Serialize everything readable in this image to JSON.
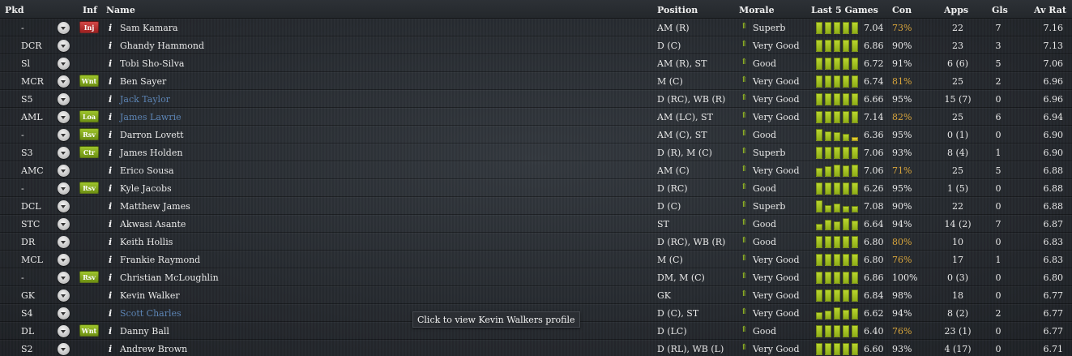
{
  "header": {
    "pkd": "Pkd",
    "inf": "Inf",
    "name": "Name",
    "position": "Position",
    "morale": "Morale",
    "last5": "Last 5 Games",
    "con": "Con",
    "apps": "Apps",
    "gls": "Gls",
    "avrat": "Av Rat"
  },
  "colors": {
    "morale_arrow": "#a6d020",
    "form_green": "#a6c622",
    "form_yellow": "#d8c62a",
    "con_warning": "#d8a53c",
    "link_blue": "#5c84b4"
  },
  "rows": [
    {
      "pkd": "-",
      "inf": "Inj",
      "inf_color": "red",
      "name": "Sam Kamara",
      "name_link": false,
      "position": "AM (R)",
      "morale": "Superb",
      "form": [
        1,
        1,
        1,
        1,
        1
      ],
      "form_rating": "7.04",
      "con": "73%",
      "con_warn": true,
      "apps": "22",
      "gls": "7",
      "avrat": "7.16"
    },
    {
      "pkd": "DCR",
      "inf": "",
      "name": "Ghandy Hammond",
      "name_link": false,
      "position": "D (C)",
      "morale": "Very Good",
      "form": [
        1,
        1,
        1,
        1,
        1
      ],
      "form_rating": "6.86",
      "con": "90%",
      "con_warn": false,
      "apps": "23",
      "gls": "3",
      "avrat": "7.13"
    },
    {
      "pkd": "Sl",
      "inf": "",
      "name": "Tobi Sho-Silva",
      "name_link": false,
      "position": "AM (R), ST",
      "morale": "Good",
      "form": [
        1,
        1,
        1,
        1,
        1
      ],
      "form_rating": "6.72",
      "con": "91%",
      "con_warn": false,
      "apps": "6 (6)",
      "gls": "5",
      "avrat": "7.06"
    },
    {
      "pkd": "MCR",
      "inf": "Wnt",
      "inf_color": "green",
      "name": "Ben Sayer",
      "name_link": false,
      "position": "M (C)",
      "morale": "Very Good",
      "form": [
        1,
        1,
        1,
        1,
        1
      ],
      "form_rating": "6.74",
      "con": "81%",
      "con_warn": true,
      "apps": "25",
      "gls": "2",
      "avrat": "6.96"
    },
    {
      "pkd": "S5",
      "inf": "",
      "name": "Jack Taylor",
      "name_link": true,
      "position": "D (RC), WB (R)",
      "morale": "Very Good",
      "form": [
        1,
        1,
        1,
        1,
        1
      ],
      "form_rating": "6.66",
      "con": "95%",
      "con_warn": false,
      "apps": "15 (7)",
      "gls": "0",
      "avrat": "6.96"
    },
    {
      "pkd": "AML",
      "inf": "Loa",
      "inf_color": "green",
      "name": "James Lawrie",
      "name_link": true,
      "position": "AM (LC), ST",
      "morale": "Very Good",
      "form": [
        1,
        1,
        1,
        1,
        1
      ],
      "form_rating": "7.14",
      "con": "82%",
      "con_warn": true,
      "apps": "25",
      "gls": "6",
      "avrat": "6.94"
    },
    {
      "pkd": "-",
      "inf": "Rsv",
      "inf_color": "green",
      "name": "Darron Lovett",
      "name_link": false,
      "position": "AM (C), ST",
      "morale": "Good",
      "form": [
        1,
        0.8,
        0.75,
        0.6,
        0.35
      ],
      "form_rating": "6.36",
      "con": "95%",
      "con_warn": false,
      "apps": "0 (1)",
      "gls": "0",
      "avrat": "6.90"
    },
    {
      "pkd": "S3",
      "inf": "Ctr",
      "inf_color": "green",
      "name": "James Holden",
      "name_link": false,
      "position": "D (R), M (C)",
      "morale": "Superb",
      "form": [
        1,
        1,
        1,
        1,
        1
      ],
      "form_rating": "7.06",
      "con": "93%",
      "con_warn": false,
      "apps": "8 (4)",
      "gls": "1",
      "avrat": "6.90"
    },
    {
      "pkd": "AMC",
      "inf": "",
      "name": "Erico Sousa",
      "name_link": false,
      "position": "AM (C)",
      "morale": "Very Good",
      "form": [
        0.75,
        0.85,
        1,
        0.9,
        1
      ],
      "form_rating": "7.06",
      "con": "71%",
      "con_warn": true,
      "apps": "25",
      "gls": "5",
      "avrat": "6.88"
    },
    {
      "pkd": "-",
      "inf": "Rsv",
      "inf_color": "green",
      "name": "Kyle Jacobs",
      "name_link": false,
      "position": "D (RC)",
      "morale": "Good",
      "form": [
        1,
        1,
        1,
        1,
        1
      ],
      "form_rating": "6.26",
      "con": "95%",
      "con_warn": false,
      "apps": "1 (5)",
      "gls": "0",
      "avrat": "6.88"
    },
    {
      "pkd": "DCL",
      "inf": "",
      "name": "Matthew James",
      "name_link": false,
      "position": "D (C)",
      "morale": "Superb",
      "form": [
        1,
        0.6,
        0.75,
        0.55,
        0.5
      ],
      "form_rating": "7.08",
      "con": "90%",
      "con_warn": false,
      "apps": "22",
      "gls": "0",
      "avrat": "6.88"
    },
    {
      "pkd": "STC",
      "inf": "",
      "name": "Akwasi Asante",
      "name_link": false,
      "position": "ST",
      "morale": "Good",
      "form": [
        0.55,
        0.85,
        0.7,
        1,
        0.8
      ],
      "form_rating": "6.64",
      "con": "94%",
      "con_warn": false,
      "apps": "14 (2)",
      "gls": "7",
      "avrat": "6.87"
    },
    {
      "pkd": "DR",
      "inf": "",
      "name": "Keith Hollis",
      "name_link": false,
      "position": "D (RC), WB (R)",
      "morale": "Good",
      "form": [
        1,
        1,
        1,
        1,
        1
      ],
      "form_rating": "6.80",
      "con": "80%",
      "con_warn": true,
      "apps": "10",
      "gls": "0",
      "avrat": "6.83"
    },
    {
      "pkd": "MCL",
      "inf": "",
      "name": "Frankie Raymond",
      "name_link": false,
      "position": "M (C)",
      "morale": "Very Good",
      "form": [
        1,
        1,
        1,
        1,
        1
      ],
      "form_rating": "6.80",
      "con": "76%",
      "con_warn": true,
      "apps": "17",
      "gls": "1",
      "avrat": "6.83"
    },
    {
      "pkd": "-",
      "inf": "Rsv",
      "inf_color": "green",
      "name": "Christian McLoughlin",
      "name_link": false,
      "position": "DM, M (C)",
      "morale": "Very Good",
      "form": [
        1,
        1,
        1,
        1,
        1
      ],
      "form_rating": "6.86",
      "con": "100%",
      "con_warn": false,
      "apps": "0 (3)",
      "gls": "0",
      "avrat": "6.80"
    },
    {
      "pkd": "GK",
      "inf": "",
      "name": "Kevin Walker",
      "name_link": false,
      "position": "GK",
      "morale": "Very Good",
      "form": [
        1,
        1,
        1,
        1,
        1
      ],
      "form_rating": "6.84",
      "con": "98%",
      "con_warn": false,
      "apps": "18",
      "gls": "0",
      "avrat": "6.77"
    },
    {
      "pkd": "S4",
      "inf": "",
      "name": "Scott Charles",
      "name_link": true,
      "position": "D (C), ST",
      "morale": "Very Good",
      "form": [
        0.6,
        0.75,
        1,
        0.8,
        0.9
      ],
      "form_rating": "6.62",
      "con": "94%",
      "con_warn": false,
      "apps": "8 (2)",
      "gls": "2",
      "avrat": "6.77"
    },
    {
      "pkd": "DL",
      "inf": "Wnt",
      "inf_color": "green",
      "name": "Danny Ball",
      "name_link": false,
      "position": "D (LC)",
      "morale": "Good",
      "form": [
        1,
        1,
        1,
        1,
        1
      ],
      "form_rating": "6.40",
      "con": "76%",
      "con_warn": true,
      "apps": "23 (1)",
      "gls": "0",
      "avrat": "6.77"
    },
    {
      "pkd": "S2",
      "inf": "",
      "name": "Andrew Brown",
      "name_link": false,
      "position": "D (RL), WB (L)",
      "morale": "Very Good",
      "form": [
        1,
        1,
        1,
        1,
        1
      ],
      "form_rating": "6.60",
      "con": "93%",
      "con_warn": false,
      "apps": "4 (17)",
      "gls": "0",
      "avrat": "6.71"
    }
  ],
  "tooltip": "Click to view Kevin Walkers profile"
}
